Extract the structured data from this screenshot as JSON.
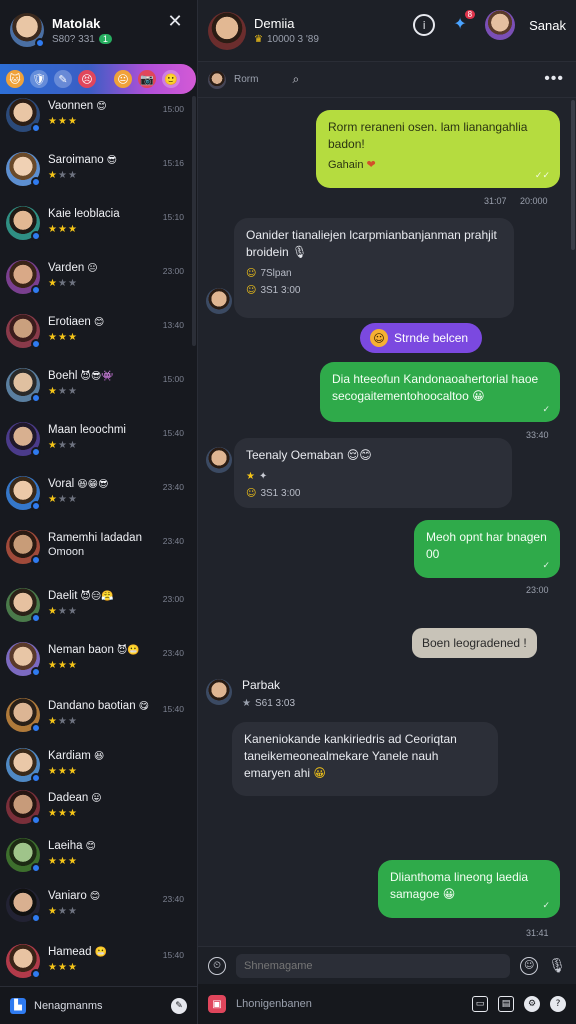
{
  "sidebar": {
    "user": {
      "name": "Matolak",
      "sub": "S80? 331",
      "badge": "1"
    },
    "filters": [
      "🐱",
      "🛡",
      "✎",
      "😣",
      "😐",
      "📷",
      "🙂"
    ],
    "contacts": [
      {
        "name": "Vaonnen",
        "emoji": "😊",
        "stars": 3,
        "time": "15:00"
      },
      {
        "name": "Saroimano",
        "emoji": "😎",
        "stars": 1,
        "time": "15:16"
      },
      {
        "name": "Kaie leoblacia",
        "emoji": "",
        "stars": 3,
        "time": "15:10"
      },
      {
        "name": "Varden",
        "emoji": "😐",
        "stars": 1,
        "time": "23:00"
      },
      {
        "name": "Erotiaen",
        "emoji": "😊",
        "stars": 3,
        "time": "13:40"
      },
      {
        "name": "Boehl",
        "emoji": "😈😎👾",
        "stars": 1,
        "time": "15:00"
      },
      {
        "name": "Maan leoochmi",
        "emoji": "",
        "stars": 1,
        "time": "15:40"
      },
      {
        "name": "Voral",
        "emoji": "😆😁😎",
        "stars": 1,
        "time": "23:40"
      },
      {
        "name": "Ramemhi Iadadan",
        "sub": "Omoon",
        "emoji": "",
        "stars": 0,
        "time": "23:40"
      },
      {
        "name": "Daelit",
        "emoji": "😈😑😤",
        "stars": 1,
        "time": "23:00"
      },
      {
        "name": "Neman baon",
        "emoji": "😈😬",
        "stars": 3,
        "time": "23:40"
      },
      {
        "name": "Dandano baotian",
        "emoji": "😋",
        "stars": 1,
        "time": "15:40"
      },
      {
        "name": "Kardiam",
        "emoji": "😆",
        "stars": 3,
        "time": ""
      },
      {
        "name": "Dadean",
        "emoji": "😛",
        "stars": 3,
        "time": ""
      },
      {
        "name": "Laeiha",
        "emoji": "😊",
        "stars": 3,
        "time": ""
      },
      {
        "name": "Vaniaro",
        "emoji": "😊",
        "stars": 1,
        "time": "23:40"
      },
      {
        "name": "Hamead",
        "emoji": "😬",
        "stars": 3,
        "time": "15:40"
      }
    ],
    "footer": "Nenagmanms"
  },
  "chat": {
    "contact": {
      "name": "Demiia",
      "sub": "10000 3 '89"
    },
    "notif_count": "8",
    "profile_name": "Sanak",
    "sub_name": "Rorm",
    "messages": {
      "m1": {
        "text": "Rorm reraneni osen. lam lianangahlia badon!",
        "extra": "Gahain",
        "emoji": "❤",
        "time": "31:07",
        "time2": "20:000"
      },
      "m2": {
        "text": "Oanider tianaliejen lcarpmianbanjanman prahjit broidein",
        "emoji": "🎙",
        "meta1": "7Slpan",
        "meta2": "3S1 3:00"
      },
      "pill": "Strnde belcen",
      "m3": {
        "text": "Dia hteeofun Kandonaoahertorial haoe secogaitementohoocaltoo",
        "emoji": "😀",
        "time": "33:40"
      },
      "m4": {
        "name": "Teenaly Oemaban",
        "emoji": "😌😊",
        "meta": "3S1 3:00"
      },
      "m5": {
        "text": "Meoh opnt har bnagen 00",
        "time": "23:00"
      },
      "pill2": "Boen leogradened !",
      "m6": {
        "name": "Parbak",
        "meta": "S61 3:03"
      },
      "m7": {
        "text": "Kaneniokande kankiriedris ad Ceoriqtan taneikemeonealmekare Yanele nauh emaryen ahi",
        "emoji": "😀"
      },
      "m8": {
        "text": "Dlianthoma lineong laedia samagoe",
        "emoji": "😀",
        "time": "31:41"
      }
    },
    "composer_placeholder": "Shnemagame",
    "bottom_text": "Lhonigenbanen"
  }
}
